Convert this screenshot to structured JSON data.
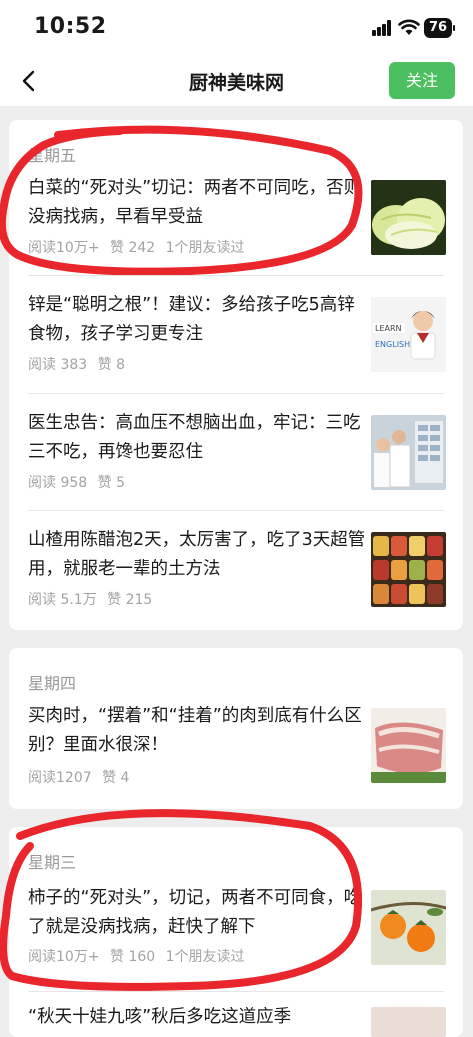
{
  "status_bar": {
    "time": "10:52",
    "battery": "76"
  },
  "nav": {
    "title": "厨神美味网",
    "follow_label": "关注"
  },
  "colors": {
    "accent_green": "#4cc060",
    "annotation_red": "#e8262b"
  },
  "sections": [
    {
      "day": "星期五",
      "articles": [
        {
          "title": "白菜的“死对头”切记：两者不可同吃，否则没病找病，早看早受益",
          "reads": "阅读10万+",
          "likes": "赞 242",
          "friends": "1个朋友读过",
          "thumb": "cabbage-image"
        },
        {
          "title": "锌是“聪明之根”！建议：多给孩子吃5高锌食物，孩子学习更专注",
          "reads": "阅读 383",
          "likes": "赞 8",
          "friends": "",
          "thumb": "child-english-image"
        },
        {
          "title": "医生忠告：高血压不想脑出血，牢记：三吃三不吃，再馋也要忍住",
          "reads": "阅读 958",
          "likes": "赞 5",
          "friends": "",
          "thumb": "doctors-image"
        },
        {
          "title": "山楂用陈醋泡2天，太厉害了，吃了3天超管用，就服老一辈的土方法",
          "reads": "阅读 5.1万",
          "likes": "赞 215",
          "friends": "",
          "thumb": "jars-image"
        }
      ]
    },
    {
      "day": "星期四",
      "articles": [
        {
          "title": "买肉时，“摆着”和“挂着”的肉到底有什么区别？里面水很深！",
          "reads": "阅读1207",
          "likes": "赞 4",
          "friends": "",
          "thumb": "meat-image"
        }
      ]
    },
    {
      "day": "星期三",
      "articles": [
        {
          "title": "柿子的“死对头”，切记，两者不可同食，吃了就是没病找病，赶快了解下",
          "reads": "阅读10万+",
          "likes": "赞 160",
          "friends": "1个朋友读过",
          "thumb": "persimmon-image"
        },
        {
          "title": "“秋天十娃九咳”秋后多吃这道应季",
          "reads": "",
          "likes": "",
          "friends": "",
          "thumb": "partial-image"
        }
      ]
    }
  ],
  "icons": {
    "back": "chevron-left-icon",
    "signal": "signal-icon",
    "wifi": "wifi-icon",
    "battery": "battery-icon"
  }
}
